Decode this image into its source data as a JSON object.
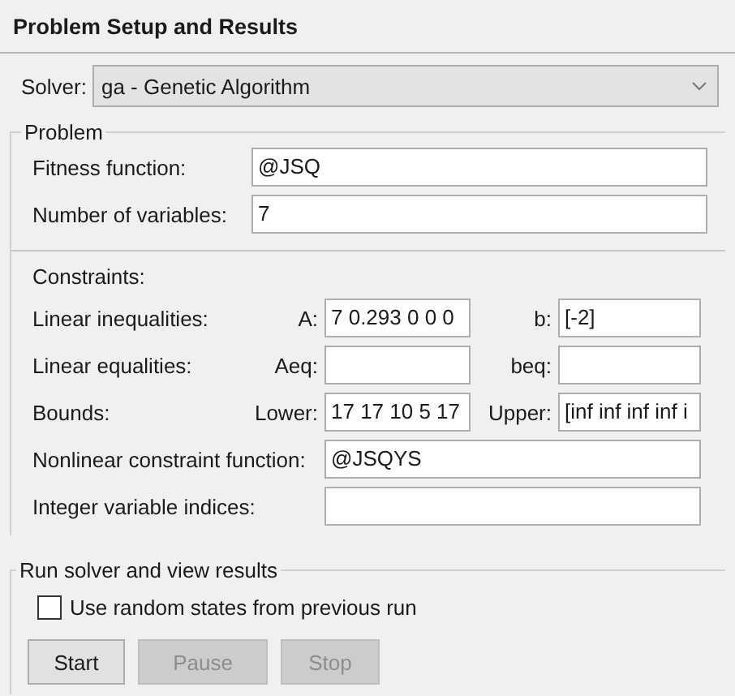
{
  "panel": {
    "title": "Problem Setup and Results"
  },
  "solver": {
    "label": "Solver:",
    "value": "ga - Genetic Algorithm"
  },
  "problem": {
    "title": "Problem",
    "rows": [
      {
        "label": "Fitness function:",
        "value": "@JSQ"
      },
      {
        "label": "Number of variables:",
        "value": "7"
      }
    ],
    "constraints": {
      "title": "Constraints:",
      "rows": [
        {
          "kind": "pair",
          "label": "Linear inequalities:",
          "fields": [
            {
              "label": "A:",
              "value": "7 0.293 0 0 0"
            },
            {
              "label": "b:",
              "value": "[-2]"
            }
          ]
        },
        {
          "kind": "pair",
          "label": "Linear equalities:",
          "fields": [
            {
              "label": "Aeq:"
            },
            {
              "label": "beq:"
            }
          ]
        },
        {
          "kind": "pair",
          "label": "Bounds:",
          "fields": [
            {
              "label": "Lower:",
              "value": "17 17 10 5 17"
            },
            {
              "label": "Upper:",
              "value": "[inf inf inf inf i"
            }
          ]
        },
        {
          "kind": "single",
          "label": "Nonlinear constraint function:",
          "value": "@JSQYS"
        },
        {
          "kind": "single",
          "label": "Integer variable indices:"
        }
      ]
    }
  },
  "run": {
    "title": "Run solver and view results",
    "checkbox": {
      "label": "Use random states from previous run",
      "checked": false
    },
    "buttons": [
      {
        "label": "Start",
        "disabled": false
      },
      {
        "label": "Pause",
        "disabled": true
      },
      {
        "label": "Stop",
        "disabled": true
      }
    ]
  }
}
